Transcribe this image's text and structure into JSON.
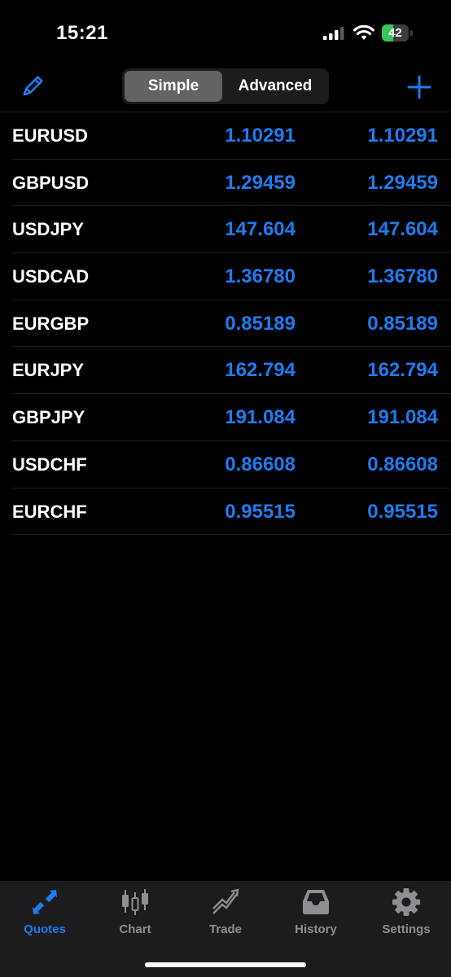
{
  "status_bar": {
    "time": "15:21",
    "battery_percent": "42",
    "battery_level": 0.42
  },
  "header": {
    "tabs": [
      {
        "label": "Simple",
        "selected": true
      },
      {
        "label": "Advanced",
        "selected": false
      }
    ]
  },
  "colors": {
    "accent": "#1f7cf0",
    "inactive": "#8e8e93",
    "background": "#000000"
  },
  "quotes": [
    {
      "symbol": "EURUSD",
      "bid": "1.10291",
      "ask": "1.10291"
    },
    {
      "symbol": "GBPUSD",
      "bid": "1.29459",
      "ask": "1.29459"
    },
    {
      "symbol": "USDJPY",
      "bid": "147.604",
      "ask": "147.604"
    },
    {
      "symbol": "USDCAD",
      "bid": "1.36780",
      "ask": "1.36780"
    },
    {
      "symbol": "EURGBP",
      "bid": "0.85189",
      "ask": "0.85189"
    },
    {
      "symbol": "EURJPY",
      "bid": "162.794",
      "ask": "162.794"
    },
    {
      "symbol": "GBPJPY",
      "bid": "191.084",
      "ask": "191.084"
    },
    {
      "symbol": "USDCHF",
      "bid": "0.86608",
      "ask": "0.86608"
    },
    {
      "symbol": "EURCHF",
      "bid": "0.95515",
      "ask": "0.95515"
    }
  ],
  "tab_bar": {
    "items": [
      {
        "label": "Quotes",
        "icon": "quotes-icon",
        "active": true
      },
      {
        "label": "Chart",
        "icon": "chart-icon",
        "active": false
      },
      {
        "label": "Trade",
        "icon": "trade-icon",
        "active": false
      },
      {
        "label": "History",
        "icon": "history-icon",
        "active": false
      },
      {
        "label": "Settings",
        "icon": "gear-icon",
        "active": false
      }
    ]
  }
}
